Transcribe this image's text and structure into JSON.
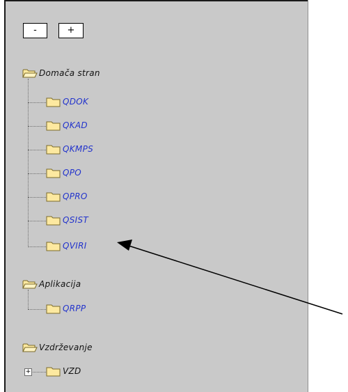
{
  "toolbar": {
    "collapse_label": "-",
    "expand_label": "+"
  },
  "tree": {
    "root1": {
      "label": "Domača stran"
    },
    "root1_children": [
      "QDOK",
      "QKAD",
      "QKMPS",
      "QPO",
      "QPRO",
      "QSIST",
      "QVIRI"
    ],
    "root2": {
      "label": "Aplikacija"
    },
    "root2_children": [
      "QRPP"
    ],
    "root3": {
      "label": "Vzdrževanje"
    },
    "root3_children": [
      "VZD"
    ]
  },
  "colors": {
    "panel_bg": "#c9c9c9",
    "child_link": "#2233cc",
    "folder_fill": "#fde9a0"
  }
}
